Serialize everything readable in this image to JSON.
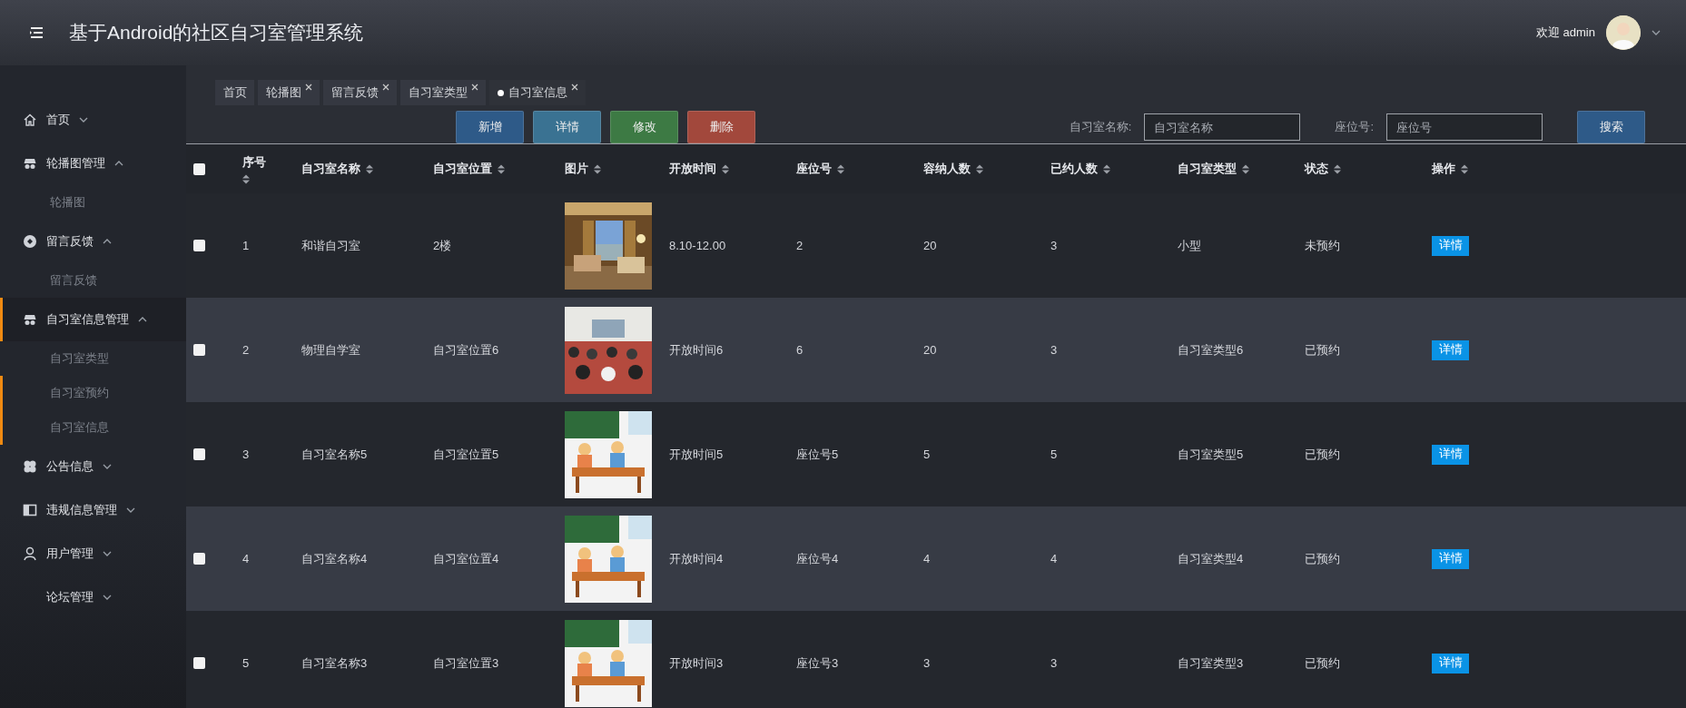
{
  "header": {
    "title": "基于Android的社区自习室管理系统",
    "welcome": "欢迎 admin"
  },
  "sidebar": {
    "items": [
      {
        "label": "首页",
        "expanded": false,
        "selected": false
      },
      {
        "label": "轮播图管理",
        "expanded": true,
        "selected": false,
        "children": [
          {
            "label": "轮播图",
            "selected": false
          }
        ]
      },
      {
        "label": "留言反馈",
        "expanded": true,
        "selected": false,
        "children": [
          {
            "label": "留言反馈",
            "selected": false
          }
        ]
      },
      {
        "label": "自习室信息管理",
        "expanded": true,
        "selected": true,
        "children": [
          {
            "label": "自习室类型",
            "selected": false
          },
          {
            "label": "自习室预约",
            "selected": true
          },
          {
            "label": "自习室信息",
            "selected": true
          }
        ]
      },
      {
        "label": "公告信息",
        "expanded": false,
        "selected": false
      },
      {
        "label": "违规信息管理",
        "expanded": false,
        "selected": false
      },
      {
        "label": "用户管理",
        "expanded": false,
        "selected": false
      },
      {
        "label": "论坛管理",
        "expanded": false,
        "selected": false
      }
    ]
  },
  "tabs": [
    {
      "label": "首页",
      "closable": false,
      "selected": false
    },
    {
      "label": "轮播图",
      "closable": true,
      "selected": false
    },
    {
      "label": "留言反馈",
      "closable": true,
      "selected": false
    },
    {
      "label": "自习室类型",
      "closable": true,
      "selected": false
    },
    {
      "label": "自习室信息",
      "closable": true,
      "selected": true
    }
  ],
  "actions": [
    {
      "label": "新增",
      "color": "#2e5a88"
    },
    {
      "label": "详情",
      "color": "#3a7292"
    },
    {
      "label": "修改",
      "color": "#3d7a44"
    },
    {
      "label": "删除",
      "color": "#a2483c"
    }
  ],
  "search": {
    "fields": [
      {
        "label": "自习室名称:",
        "placeholder": "自习室名称"
      },
      {
        "label": "座位号:",
        "placeholder": "座位号"
      }
    ],
    "button": "搜索"
  },
  "table": {
    "select_all": {
      "checked": false
    },
    "columns": [
      "序号",
      "自习室名称",
      "自习室位置",
      "图片",
      "开放时间",
      "座位号",
      "容纳人数",
      "已约人数",
      "自习室类型",
      "状态",
      "操作"
    ],
    "rows": [
      {
        "checked": false,
        "cells": [
          "1",
          "和谐自习室",
          "2楼",
          {
            "kind": "picture"
          },
          "8.10-12.00",
          "2",
          "20",
          "3",
          "小型",
          "未预约"
        ],
        "action": "详情"
      },
      {
        "checked": false,
        "cells": [
          "2",
          "物理自学室",
          "自习室位置6",
          {
            "kind": "picture"
          },
          "开放时间6",
          "6",
          "20",
          "3",
          "自习室类型6",
          "已预约"
        ],
        "action": "详情"
      },
      {
        "checked": false,
        "cells": [
          "3",
          "自习室名称5",
          "自习室位置5",
          {
            "kind": "picture"
          },
          "开放时间5",
          "座位号5",
          "5",
          "5",
          "自习室类型5",
          "已预约"
        ],
        "action": "详情"
      },
      {
        "checked": false,
        "cells": [
          "4",
          "自习室名称4",
          "自习室位置4",
          {
            "kind": "picture"
          },
          "开放时间4",
          "座位号4",
          "4",
          "4",
          "自习室类型4",
          "已预约"
        ],
        "action": "详情"
      },
      {
        "checked": false,
        "cells": [
          "5",
          "自习室名称3",
          "自习室位置3",
          {
            "kind": "picture"
          },
          "开放时间3",
          "座位号3",
          "3",
          "3",
          "自习室类型3",
          "已预约"
        ],
        "action": "详情"
      }
    ]
  }
}
